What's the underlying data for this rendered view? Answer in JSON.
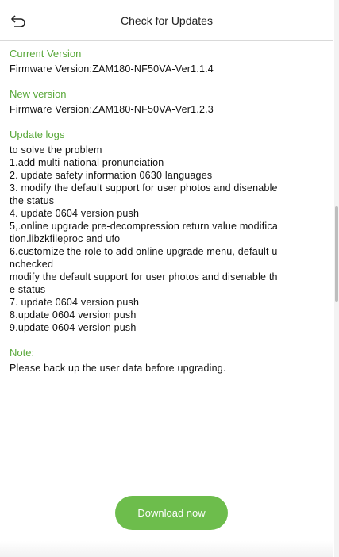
{
  "header": {
    "title": "Check for Updates",
    "back_icon": "back-arrow-icon"
  },
  "current": {
    "heading": "Current Version",
    "value": "Firmware Version:ZAM180-NF50VA-Ver1.1.4"
  },
  "new": {
    "heading": "New version",
    "value": "Firmware Version:ZAM180-NF50VA-Ver1.2.3"
  },
  "logs": {
    "heading": "Update logs",
    "lines": [
      "to solve the problem",
      "1.add multi-national pronunciation",
      "2. update safety information 0630 languages",
      "3. modify the default support for user photos and disenable",
      " the status",
      "4. update 0604 version push",
      "5,.online upgrade pre-decompression return value modifica",
      "tion.libzkfileproc and ufo",
      "6.customize the role to add online upgrade menu, default u",
      "nchecked",
      "modify the default support for user photos and disenable th",
      "e status",
      "7. update 0604 version push",
      "8.update 0604 version push",
      "9.update 0604 version push"
    ]
  },
  "note": {
    "heading": "Note:",
    "text": "Please back up the user data before upgrading."
  },
  "action": {
    "download_label": "Download now",
    "accent_color": "#6dbd4c",
    "heading_color": "#59a83a"
  }
}
